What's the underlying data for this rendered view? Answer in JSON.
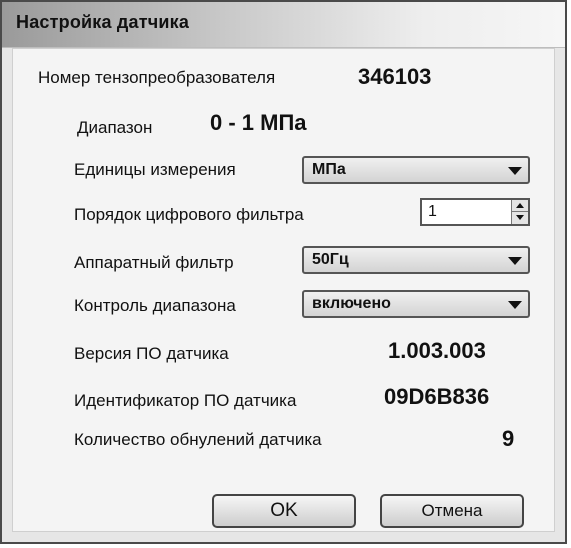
{
  "window": {
    "title": "Настройка датчика"
  },
  "sensor": {
    "converter_number_label": "Номер тензопреобразователя",
    "converter_number_value": "346103",
    "range_label": "Диапазон",
    "range_value": "0 - 1 МПа",
    "units_label": "Единицы измерения",
    "units_value": "МПа",
    "filter_order_label": "Порядок цифрового фильтра",
    "filter_order_value": "1",
    "hw_filter_label": "Аппаратный фильтр",
    "hw_filter_value": "50Гц",
    "range_control_label": "Контроль диапазона",
    "range_control_value": "включено",
    "fw_version_label": "Версия ПО датчика",
    "fw_version_value": "1.003.003",
    "fw_id_label": "Идентификатор ПО датчика",
    "fw_id_value": "09D6B836",
    "zeroing_count_label": "Количество обнулений датчика",
    "zeroing_count_value": "9"
  },
  "buttons": {
    "ok_label": "OK",
    "cancel_label": "Отмена"
  }
}
